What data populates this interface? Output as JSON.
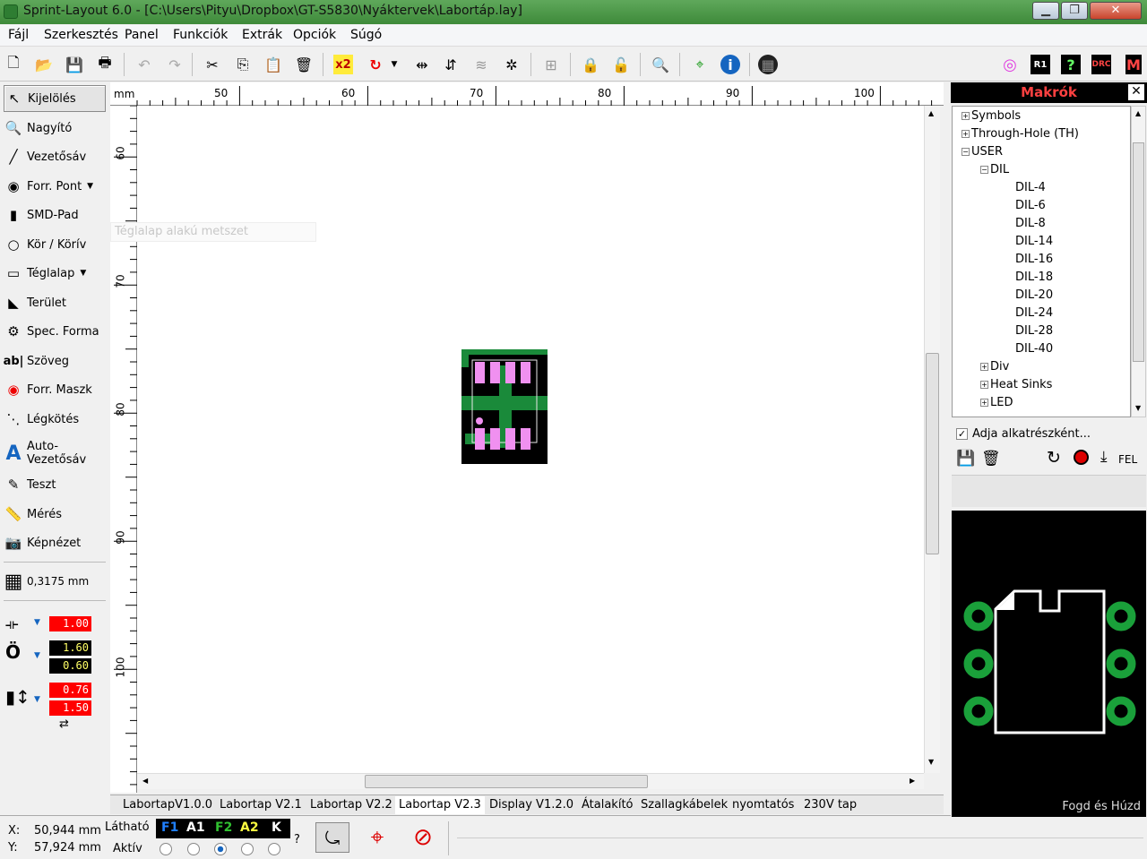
{
  "window": {
    "title": "Sprint-Layout 6.0 - [C:\\Users\\Pityu\\Dropbox\\GT-S5830\\Nyáktervek\\Labortáp.lay]"
  },
  "menu": [
    "Fájl",
    "Szerkesztés",
    "Panel",
    "Funkciók",
    "Extrák",
    "Opciók",
    "Súgó"
  ],
  "toolbar": {
    "x2_label": "x2",
    "r1_label": "R1",
    "drc_label": "DRC",
    "m_label": "M"
  },
  "tools": [
    {
      "label": "Kijelölés",
      "icon": "arrow-icon"
    },
    {
      "label": "Nagyító",
      "icon": "magnifier-icon"
    },
    {
      "label": "Vezetősáv",
      "icon": "track-icon"
    },
    {
      "label": "Forr. Pont",
      "icon": "pad-icon"
    },
    {
      "label": "SMD-Pad",
      "icon": "smd-pad-icon"
    },
    {
      "label": "Kör / Körív",
      "icon": "circle-icon"
    },
    {
      "label": "Téglalap",
      "icon": "rectangle-icon"
    },
    {
      "label": "Terület",
      "icon": "zone-icon"
    },
    {
      "label": "Spec. Forma",
      "icon": "special-form-icon"
    },
    {
      "label": "Szöveg",
      "icon": "text-icon"
    },
    {
      "label": "Forr. Maszk",
      "icon": "solder-mask-icon"
    },
    {
      "label": "Légkötés",
      "icon": "airwire-icon"
    },
    {
      "label": "Auto-\nVezetősáv",
      "icon": "autoroute-icon"
    },
    {
      "label": "Teszt",
      "icon": "test-icon"
    },
    {
      "label": "Mérés",
      "icon": "measure-icon"
    },
    {
      "label": "Képnézet",
      "icon": "photoview-icon"
    }
  ],
  "tooltip": "Téglalap alakú metszet",
  "text_icon_glyph": "ab|",
  "grid": {
    "value": "0,3175 mm"
  },
  "params": {
    "track_width": "1.00",
    "pad_outer": "1.60",
    "pad_inner": "0.60",
    "smd_w": "0.76",
    "smd_h": "1.50"
  },
  "ruler": {
    "unit": "mm",
    "top": [
      "50",
      "60",
      "70",
      "80",
      "90",
      "100"
    ],
    "left": [
      "60",
      "70",
      "80",
      "90",
      "100"
    ]
  },
  "tabs": [
    "LabortapV1.0.0",
    "Labortap V2.1",
    "Labortap V2.2",
    "Labortap V2.3",
    "Display V1.2.0",
    "Átalakító",
    "Szallagkábelek",
    "nyomtatós",
    "230V tap"
  ],
  "active_tab": 3,
  "status": {
    "x_label": "X:",
    "x_value": "50,944 mm",
    "y_label": "Y:",
    "y_value": "57,924 mm",
    "visible_label": "Látható",
    "active_label": "Aktív",
    "layers": [
      "F1",
      "A1",
      "F2",
      "A2",
      "K"
    ],
    "layer_colors": [
      "#2080ff",
      "#ffffff",
      "#30c030",
      "#ffff40",
      "#ffffff"
    ],
    "question": "?"
  },
  "macros": {
    "title": "Makrók",
    "tree": [
      {
        "label": "Symbols",
        "level": 0,
        "sign": "+"
      },
      {
        "label": "Through-Hole (TH)",
        "level": 0,
        "sign": "+"
      },
      {
        "label": "USER",
        "level": 0,
        "sign": "-"
      },
      {
        "label": "DIL",
        "level": 1,
        "sign": "-"
      },
      {
        "label": "DIL-4",
        "level": 2
      },
      {
        "label": "DIL-6",
        "level": 2
      },
      {
        "label": "DIL-8",
        "level": 2
      },
      {
        "label": "DIL-14",
        "level": 2
      },
      {
        "label": "DIL-16",
        "level": 2
      },
      {
        "label": "DIL-18",
        "level": 2
      },
      {
        "label": "DIL-20",
        "level": 2
      },
      {
        "label": "DIL-24",
        "level": 2
      },
      {
        "label": "DIL-28",
        "level": 2
      },
      {
        "label": "DIL-40",
        "level": 2
      },
      {
        "label": "Div",
        "level": 1,
        "sign": "+"
      },
      {
        "label": "Heat Sinks",
        "level": 1,
        "sign": "+"
      },
      {
        "label": "LED",
        "level": 1,
        "sign": "+"
      }
    ],
    "add_as_component": "Adja alkatrészként...",
    "add_checked": true,
    "up_label": "FEL",
    "preview_caption": "Fogd és Húzd"
  }
}
